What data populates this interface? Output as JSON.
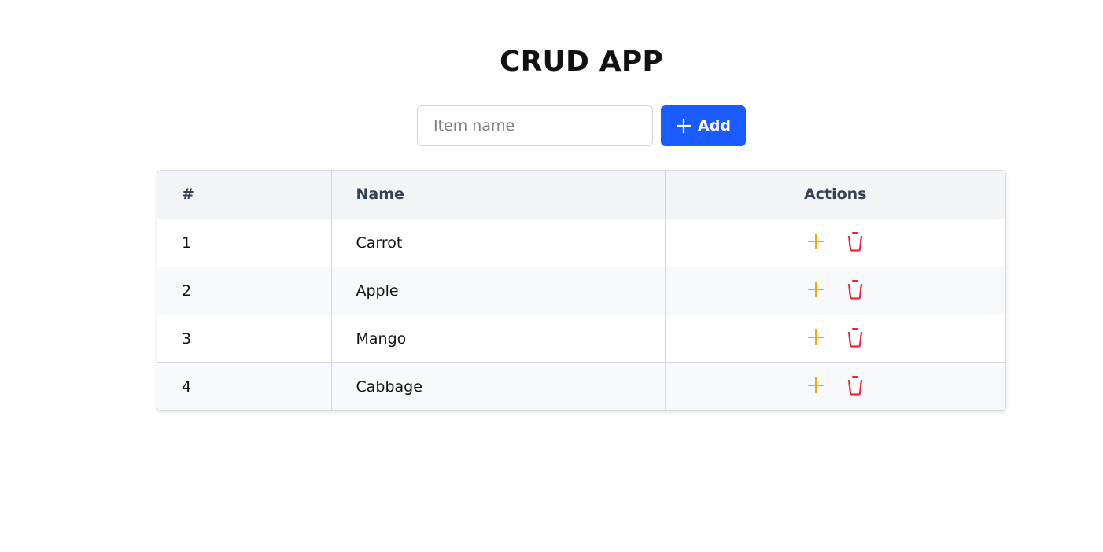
{
  "app": {
    "title": "CRUD APP"
  },
  "form": {
    "input_value": "",
    "input_placeholder": "Item name",
    "add_label": "Add"
  },
  "table": {
    "headers": [
      "#",
      "Name",
      "Actions"
    ],
    "rows": [
      {
        "index": "1",
        "name": "Carrot"
      },
      {
        "index": "2",
        "name": "Apple"
      },
      {
        "index": "3",
        "name": "Mango"
      },
      {
        "index": "4",
        "name": "Cabbage"
      }
    ],
    "row_actions": [
      "plus-icon",
      "trash-icon"
    ]
  },
  "colors": {
    "add_button": "#1a5cff",
    "edit_icon": "#f2a900",
    "delete_icon": "#e8273a",
    "header_bg": "#f3f4f6"
  }
}
